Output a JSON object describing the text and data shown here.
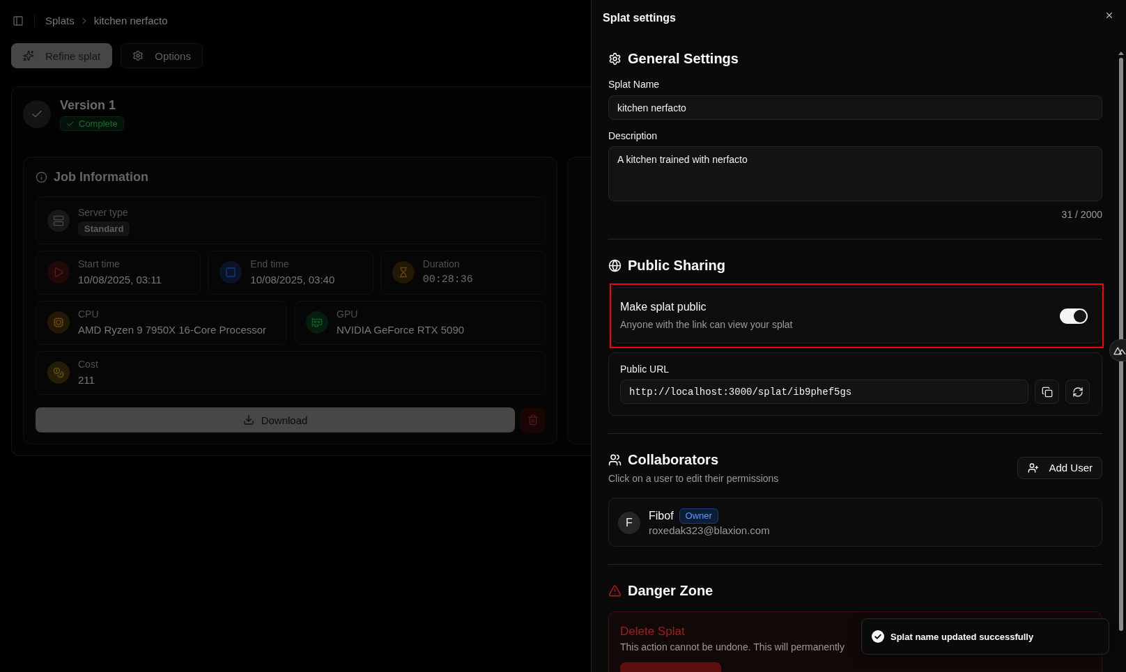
{
  "breadcrumb": [
    {
      "label": "Splats"
    },
    {
      "label": "kitchen nerfacto"
    }
  ],
  "toolbar": [
    {
      "label": "Refine splat",
      "kind": "primary"
    },
    {
      "label": "Options",
      "kind": "outline"
    }
  ],
  "version": {
    "title": "Version 1",
    "status": "Complete"
  },
  "job_information": {
    "title": "Job Information",
    "rows": [
      {
        "fields": [
          {
            "label": "Server type",
            "value": "Standard",
            "kind": "badge",
            "color": "#181818"
          }
        ]
      },
      {
        "fields": [
          {
            "label": "Start time",
            "value": "10/08/2025, 03:11",
            "kind": "text",
            "color": "#1f0909"
          },
          {
            "label": "End time",
            "value": "10/08/2025, 03:40",
            "kind": "text",
            "color": "#09132a"
          },
          {
            "label": "Duration",
            "value": "00:28:36",
            "kind": "mono",
            "color": "#231705"
          }
        ]
      },
      {
        "fields": [
          {
            "label": "CPU",
            "value": "AMD Ryzen 9 7950X 16-Core Processor",
            "kind": "text",
            "color": "#231705"
          },
          {
            "label": "GPU",
            "value": "NVIDIA GeForce RTX 5090",
            "kind": "text",
            "color": "#061e0d"
          }
        ]
      },
      {
        "fields": [
          {
            "label": "Cost",
            "value": "211",
            "kind": "text",
            "color": "#231e05"
          }
        ]
      }
    ],
    "download_button": "Download"
  },
  "settings_panel": {
    "title": "Splat settings",
    "general_settings": {
      "heading": "General Settings",
      "fields": [
        {
          "label": "Splat Name",
          "value": "kitchen nerfacto",
          "kind": "input"
        },
        {
          "label": "Description",
          "value": "A kitchen trained with nerfacto",
          "kind": "textarea"
        }
      ],
      "char_count": "31 / 2000"
    },
    "public_sharing": {
      "heading": "Public Sharing",
      "toggle": {
        "label": "Make splat public",
        "description": "Anyone with the link can view your splat",
        "on": true,
        "highlighted": true
      },
      "url": {
        "label": "Public URL",
        "value": "http://localhost:3000/splat/ib9phef5gs"
      }
    },
    "collaborators": {
      "heading": "Collaborators",
      "subtitle": "Click on a user to edit their permissions",
      "add_button": "Add User",
      "users": [
        {
          "initial": "F",
          "name": "Fibof",
          "role": "Owner",
          "email": "roxedak323@blaxion.com"
        }
      ]
    },
    "danger_zone": {
      "heading": "Danger Zone",
      "title": "Delete Splat",
      "description": "This action cannot be undone. This will permanently"
    }
  },
  "toast": {
    "message": "Splat name updated successfully"
  }
}
